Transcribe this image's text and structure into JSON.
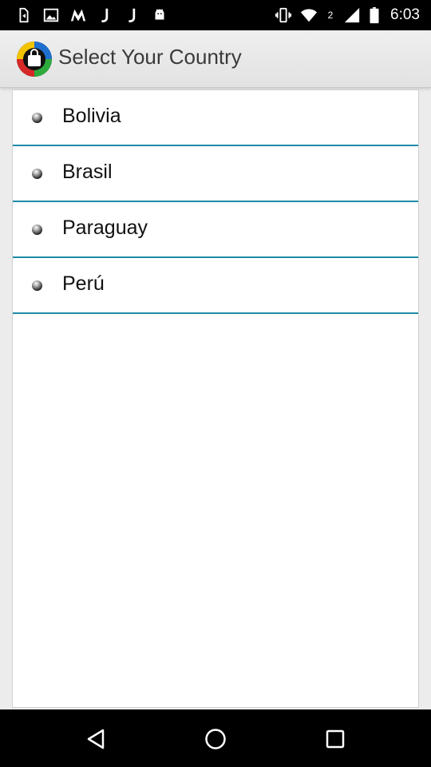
{
  "status_bar": {
    "time": "6:03",
    "left_icons": [
      "usb-debug-icon",
      "image-icon",
      "gmail-m-icon",
      "j-app-icon",
      "j-app-icon-2",
      "android-icon"
    ],
    "right_icons": [
      "vibrate-icon",
      "wifi-icon",
      "signal-icon",
      "battery-icon"
    ],
    "network_label": "2"
  },
  "action_bar": {
    "title": "Select Your Country",
    "icon": "shopping-bag-app-icon"
  },
  "countries": [
    {
      "label": "Bolivia"
    },
    {
      "label": "Brasil"
    },
    {
      "label": "Paraguay"
    },
    {
      "label": "Perú"
    }
  ],
  "colors": {
    "divider": "#1d8aa6",
    "status_bar": "#000000",
    "action_bar": "#e8e8e8",
    "content_bg": "#ffffff"
  },
  "nav_bar": {
    "buttons": [
      "back-icon",
      "home-icon",
      "recents-icon"
    ]
  }
}
